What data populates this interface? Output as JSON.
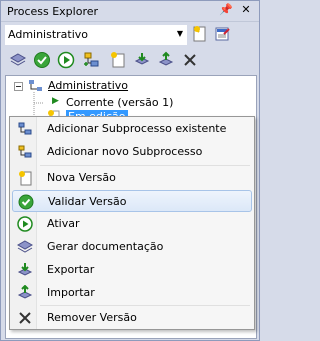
{
  "window": {
    "title": "Process Explorer",
    "pin_icon": "pin-icon",
    "close_icon": "close-icon"
  },
  "combo": {
    "selected": "Administrativo"
  },
  "toolbar": {
    "buttons": [
      "layers-icon",
      "validate-icon",
      "activate-icon",
      "add-subprocess-icon",
      "new-version-icon",
      "export-icon",
      "import-icon",
      "remove-icon"
    ]
  },
  "tree": {
    "root": "Administrativo",
    "child1": "Corrente (versão 1)",
    "child2": "Em edição"
  },
  "menu": {
    "items": [
      {
        "label": "Adicionar Subprocesso existente",
        "icon": "add-existing-subprocess-icon"
      },
      {
        "label": "Adicionar novo Subprocesso",
        "icon": "add-new-subprocess-icon"
      },
      {
        "label": "Nova Versão",
        "icon": "new-version-icon"
      },
      {
        "label": "Validar Versão",
        "icon": "validate-icon"
      },
      {
        "label": "Ativar",
        "icon": "activate-icon"
      },
      {
        "label": "Gerar documentação",
        "icon": "documentation-icon"
      },
      {
        "label": "Exportar",
        "icon": "export-icon"
      },
      {
        "label": "Importar",
        "icon": "import-icon"
      },
      {
        "label": "Remover Versão",
        "icon": "remove-icon"
      }
    ],
    "highlighted": "Validar Versão"
  },
  "colors": {
    "panel_bg": "#d6dbe9",
    "highlight": "#dce8f8",
    "green": "#3aa53a"
  }
}
